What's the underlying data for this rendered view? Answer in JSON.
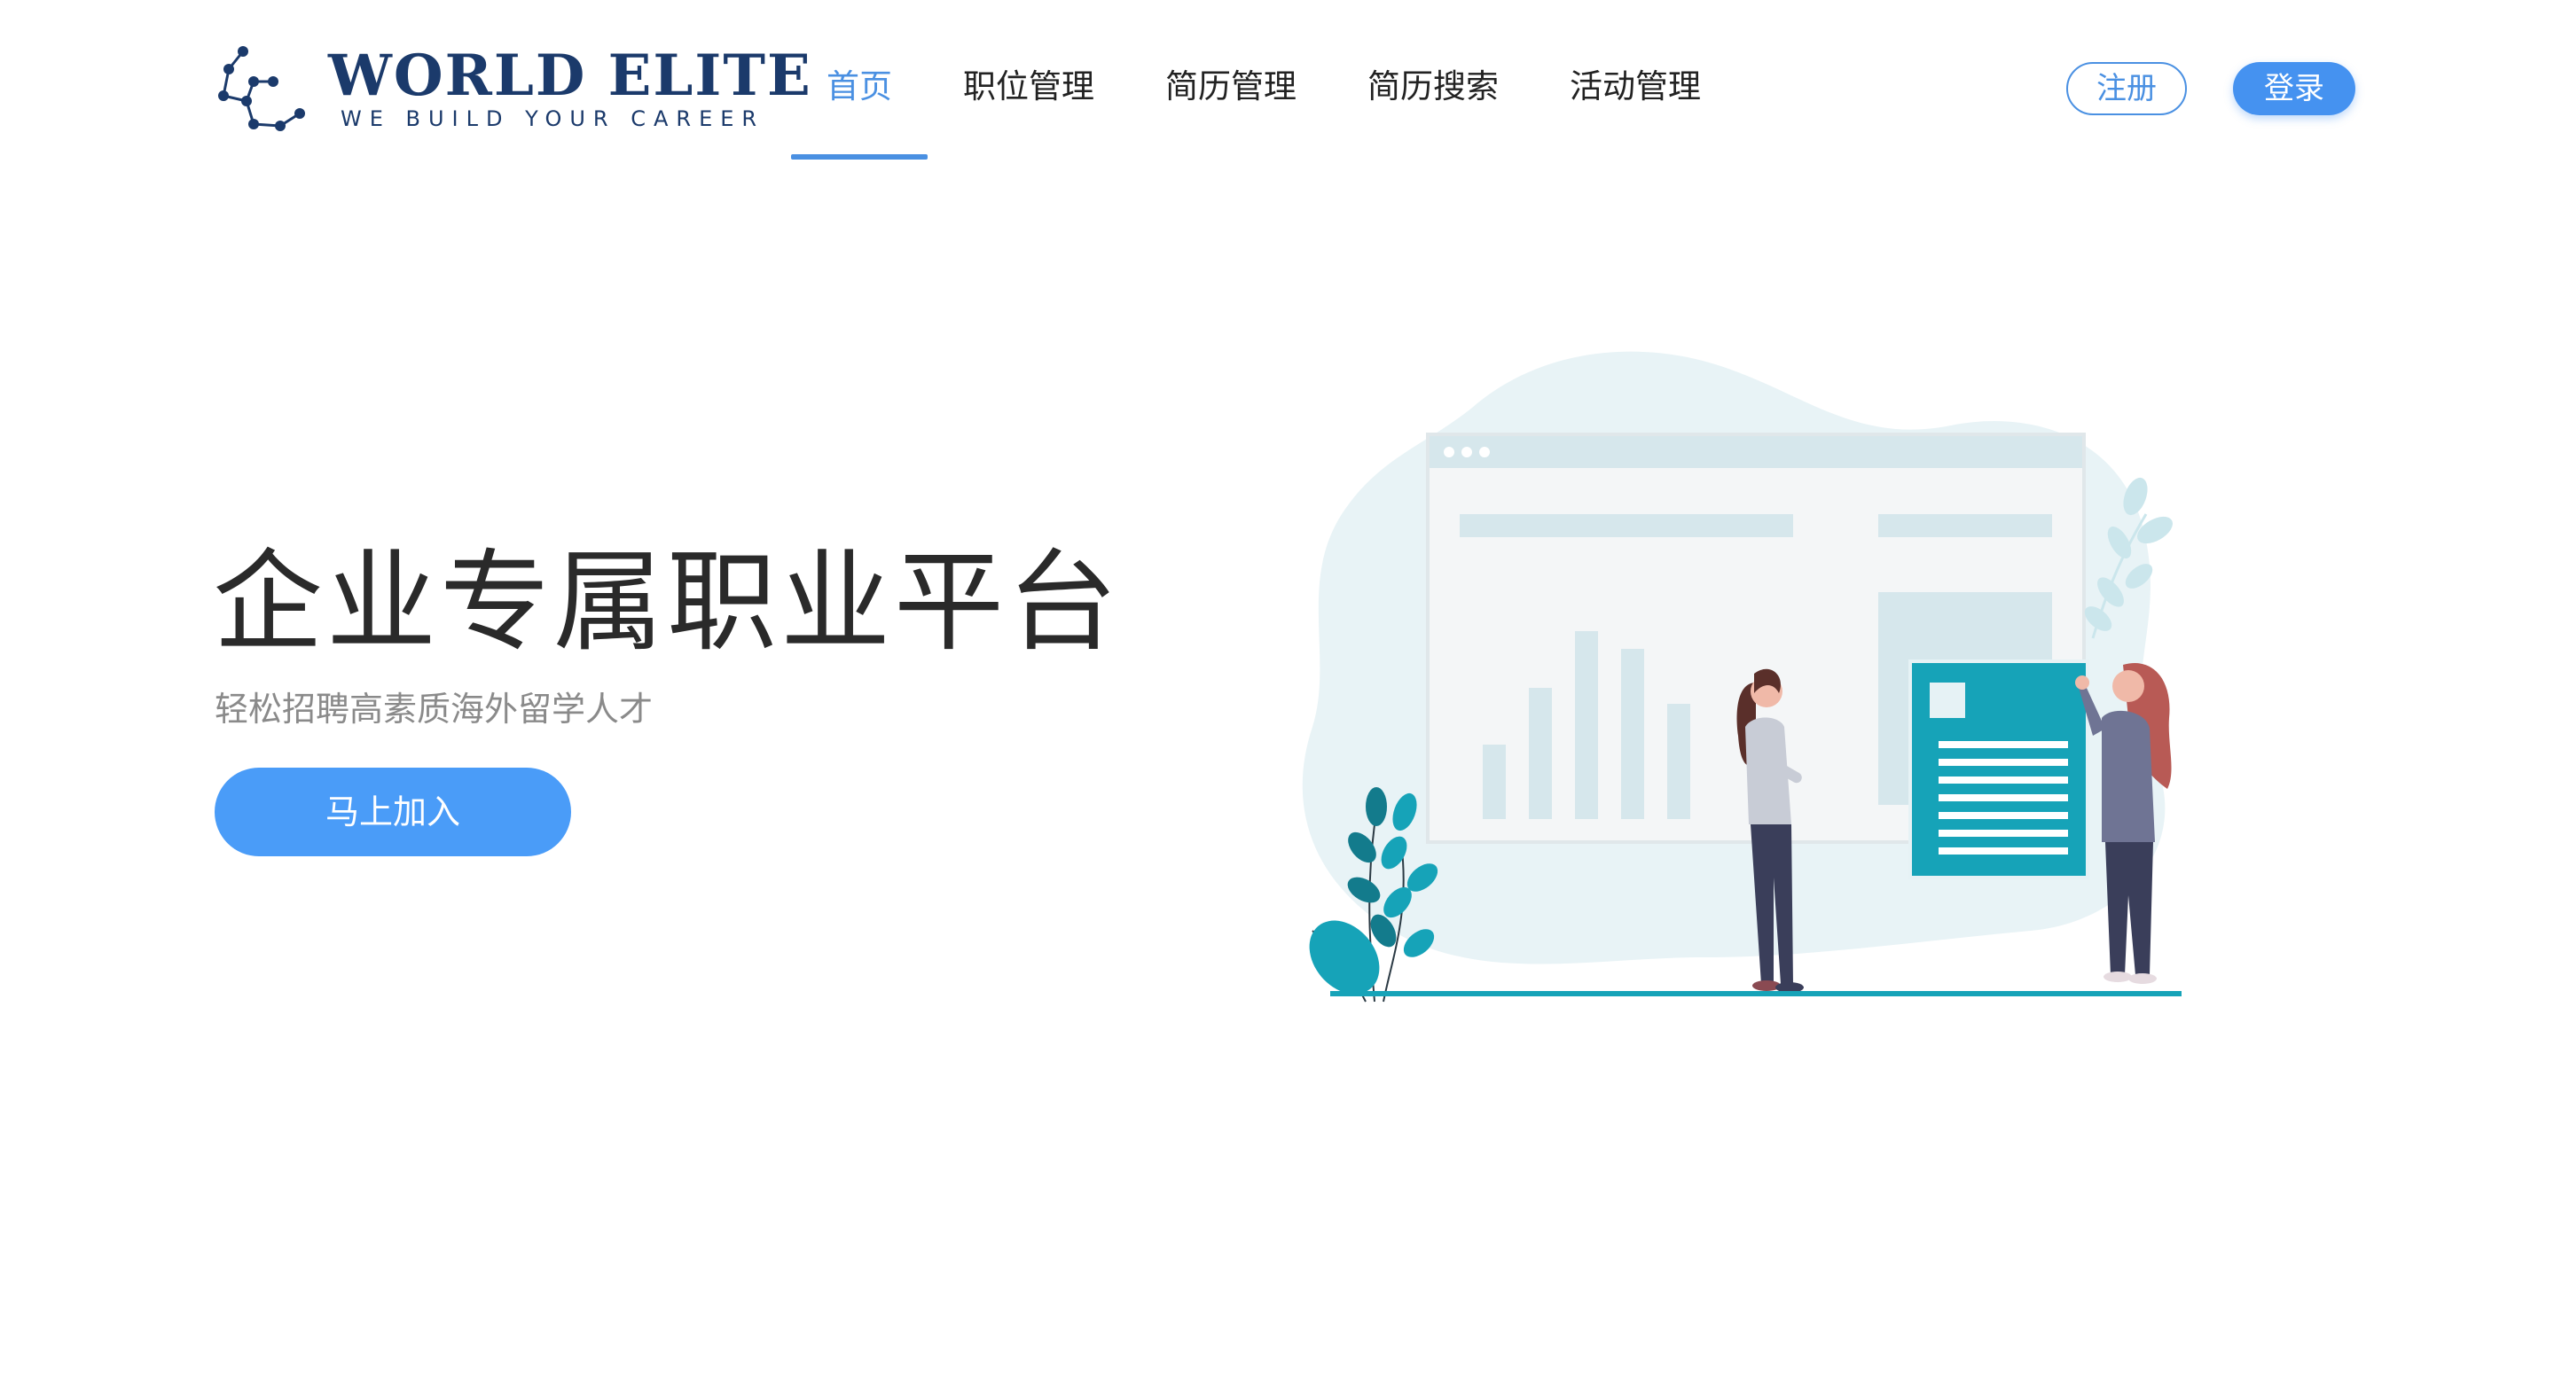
{
  "brand": {
    "title": "WORLD ELITE",
    "tagline": "WE BUILD YOUR CAREER",
    "color": "#1b3a6b"
  },
  "nav": {
    "items": [
      {
        "label": "首页",
        "active": true
      },
      {
        "label": "职位管理",
        "active": false
      },
      {
        "label": "简历管理",
        "active": false
      },
      {
        "label": "简历搜索",
        "active": false
      },
      {
        "label": "活动管理",
        "active": false
      }
    ]
  },
  "auth": {
    "register_label": "注册",
    "login_label": "登录"
  },
  "hero": {
    "title": "企业专属职业平台",
    "subtitle": "轻松招聘高素质海外留学人才",
    "cta_label": "马上加入"
  },
  "colors": {
    "accent": "#4a90e2",
    "cta": "#4a9cf8",
    "teal": "#16a3b8",
    "illustration_bg": "#e8f3f6"
  }
}
